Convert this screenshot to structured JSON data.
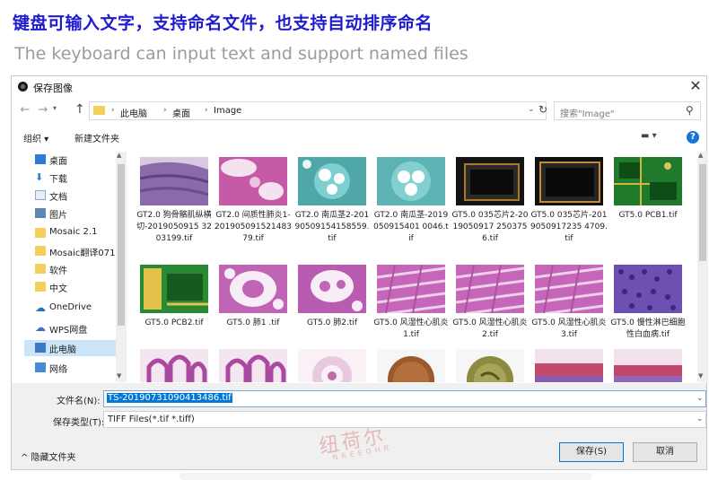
{
  "headline": {
    "cn": "键盘可输入文字，支持命名文件，也支持自动排序命名",
    "en": "The keyboard can input text and support named files"
  },
  "dialog": {
    "title": "保存图像",
    "close": "✕",
    "breadcrumb": [
      "此电脑",
      "桌面",
      "Image"
    ],
    "search_placeholder": "搜索\"Image\"",
    "toolbar": {
      "organize": "组织 ▾",
      "new_folder": "新建文件夹",
      "view": "▬ ▾",
      "help": "?"
    },
    "nav_items": [
      {
        "label": "桌面",
        "icon": "desktop-icon",
        "pinned": true
      },
      {
        "label": "下载",
        "icon": "download-icon",
        "pinned": true
      },
      {
        "label": "文档",
        "icon": "document-icon",
        "pinned": true
      },
      {
        "label": "图片",
        "icon": "pictures-icon",
        "pinned": true
      },
      {
        "label": "Mosaic 2.1",
        "icon": "folder-icon",
        "pinned": false
      },
      {
        "label": "Mosaic翻译071",
        "icon": "folder-icon",
        "pinned": false
      },
      {
        "label": "软件",
        "icon": "folder-icon",
        "pinned": false
      },
      {
        "label": "中文",
        "icon": "folder-icon",
        "pinned": false
      },
      {
        "label": "OneDrive",
        "icon": "cloud-icon",
        "pinned": false
      },
      {
        "label": "WPS网盘",
        "icon": "cloud-icon",
        "pinned": false
      },
      {
        "label": "此电脑",
        "icon": "computer-icon",
        "pinned": false
      },
      {
        "label": "网络",
        "icon": "network-icon",
        "pinned": false
      }
    ],
    "files": [
      {
        "name": "GT2.0 狗骨骼肌纵横切-2019050915 3203199.tif",
        "thumb": "muscle"
      },
      {
        "name": "GT2.0 间质性肺炎1-20190509152148379.tif",
        "thumb": "lung-pink"
      },
      {
        "name": "GT2.0 南瓜茎2-20190509154158559.tif",
        "thumb": "stem-teal"
      },
      {
        "name": "GT2.0 南瓜茎-2019050915401 0046.tif",
        "thumb": "stem-teal2"
      },
      {
        "name": "GT5.0 035芯片2-2019050917 2503756.tif",
        "thumb": "chip-dark"
      },
      {
        "name": "GT5.0 035芯片-2019050917235 4709.tif",
        "thumb": "chip-dark2"
      },
      {
        "name": "GT5.0 PCB1.tif",
        "thumb": "pcb"
      },
      {
        "name": "GT5.0 PCB2.tif",
        "thumb": "pcb2"
      },
      {
        "name": "GT5.0 肺1 .tif",
        "thumb": "lung-white"
      },
      {
        "name": "GT5.0 肺2.tif",
        "thumb": "lung-white2"
      },
      {
        "name": "GT5.0 风湿性心肌炎1.tif",
        "thumb": "myo"
      },
      {
        "name": "GT5.0 风湿性心肌炎2.tif",
        "thumb": "myo"
      },
      {
        "name": "GT5.0 风湿性心肌炎3.tif",
        "thumb": "myo"
      },
      {
        "name": "GT5.0 慢性淋巴细胞性白血病.tif",
        "thumb": "leuk"
      },
      {
        "name": "",
        "thumb": "intestine"
      },
      {
        "name": "",
        "thumb": "intestine"
      },
      {
        "name": "",
        "thumb": "stem-white"
      },
      {
        "name": "",
        "thumb": "coin"
      },
      {
        "name": "",
        "thumb": "coin2"
      },
      {
        "name": "",
        "thumb": "tissue-red"
      },
      {
        "name": "",
        "thumb": "tissue-red2"
      }
    ],
    "filename_label": "文件名(N):",
    "filename_value": "TS-20190731090413486.tif",
    "filetype_label": "保存类型(T):",
    "filetype_value": "TIFF Files(*.tif *.tiff)",
    "hide_folders": "^ 隐藏文件夹",
    "save": "保存(S)",
    "cancel": "取消"
  },
  "watermark": {
    "cn": "纽荷尔",
    "en": "NREEOHR"
  },
  "colors": {
    "headline": "#1f1bd1",
    "accent": "#0078d7"
  }
}
